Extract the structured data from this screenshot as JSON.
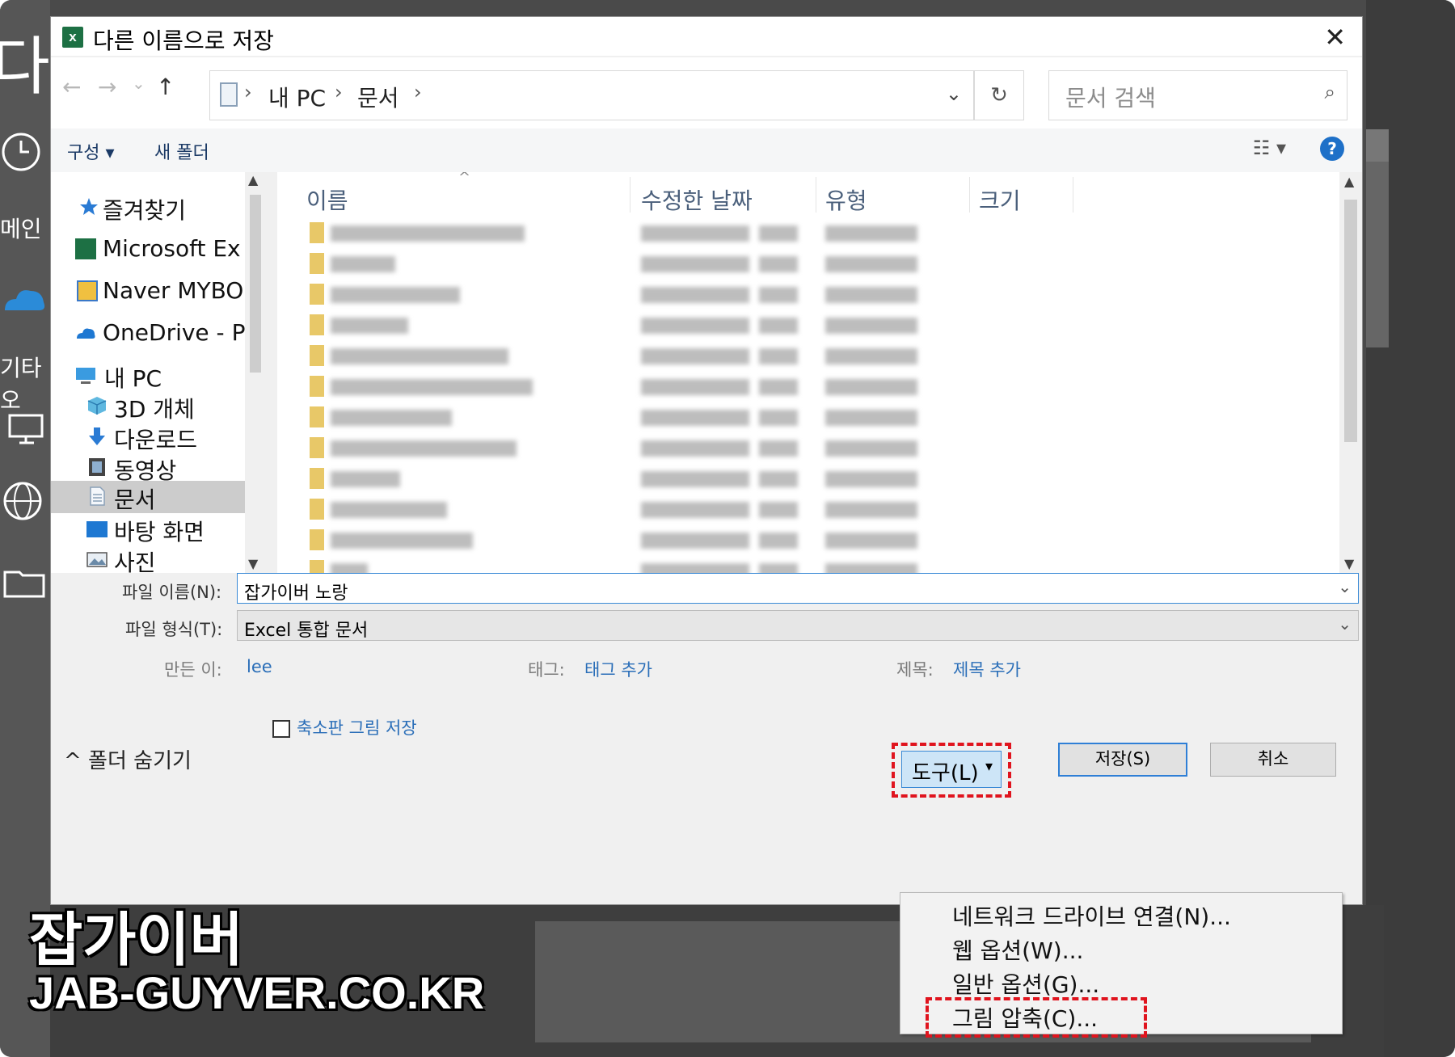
{
  "dialog": {
    "title": "다른 이름으로 저장",
    "close_glyph": "✕",
    "app_icon_letter": "x"
  },
  "navbar": {
    "back_glyph": "←",
    "forward_glyph": "→",
    "recent_glyph": "⌄",
    "up_glyph": "↑",
    "breadcrumb": [
      "내 PC",
      "문서"
    ],
    "sep_glyph": "›",
    "dropdown_glyph": "⌄",
    "refresh_glyph": "↻",
    "search_placeholder": "문서 검색",
    "search_glyph": "⌕"
  },
  "toolbar": {
    "organize": "구성 ▾",
    "new_folder": "새 폴더",
    "view_glyph": "☷ ▾",
    "help_glyph": "?"
  },
  "navpane": {
    "items": [
      {
        "label": "즐겨찾기",
        "icon": "star-icon"
      },
      {
        "label": "Microsoft Ex",
        "icon": "excel-icon"
      },
      {
        "label": "Naver MYBO",
        "icon": "naver-mybox-icon"
      },
      {
        "label": "OneDrive - P",
        "icon": "onedrive-icon"
      },
      {
        "label": "내 PC",
        "icon": "pc-icon"
      },
      {
        "label": "3D 개체",
        "icon": "cube-icon"
      },
      {
        "label": "다운로드",
        "icon": "download-icon"
      },
      {
        "label": "동영상",
        "icon": "video-icon"
      },
      {
        "label": "문서",
        "icon": "document-icon",
        "selected": true
      },
      {
        "label": "바탕 화면",
        "icon": "desktop-icon"
      },
      {
        "label": "사진",
        "icon": "picture-icon"
      }
    ]
  },
  "filelist": {
    "columns": [
      "이름",
      "수정한 날짜",
      "유형",
      "크기"
    ],
    "sort_glyph": "^"
  },
  "form": {
    "filename_label": "파일 이름(N):",
    "filename_value": "잡가이버 노랑",
    "filetype_label": "파일 형식(T):",
    "filetype_value": "Excel 통합 문서",
    "author_label": "만든 이:",
    "author_value": "lee",
    "tags_label": "태그:",
    "tags_value": "태그 추가",
    "title_label": "제목:",
    "title_value": "제목 추가",
    "thumbnail_label": "축소판 그림 저장",
    "thumbnail_checked": false
  },
  "footer": {
    "hide_folders": "^ 폴더 숨기기",
    "tools_label": "도구(L)",
    "tools_arrow": "▾",
    "save_label": "저장(S)",
    "cancel_label": "취소"
  },
  "tools_menu": {
    "items": [
      "네트워크 드라이브 연결(N)...",
      "웹 옵션(W)...",
      "일반 옵션(G)...",
      "그림 압축(C)..."
    ]
  },
  "background": {
    "partial_text": [
      "다-",
      "메인",
      "기타 오"
    ]
  },
  "watermark": {
    "line1": "잡가이버",
    "line2": "JAB-GUYVER.CO.KR"
  },
  "colors": {
    "highlight": "#e0141e",
    "accent": "#2f7fd6",
    "excel": "#1d7044"
  }
}
